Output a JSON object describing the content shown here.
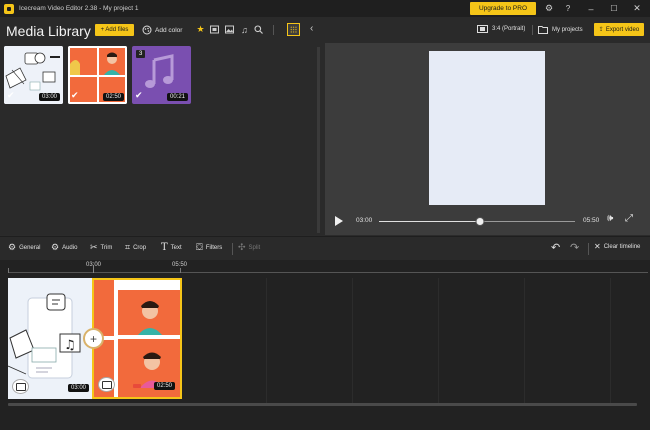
{
  "window": {
    "title": "Icecream Video Editor 2.38  -  My project 1",
    "upgrade_label": "Upgrade to PRO",
    "icons": [
      "gear-icon",
      "help-icon",
      "minimize-icon",
      "maximize-icon",
      "close-icon"
    ]
  },
  "media": {
    "title": "Media Library",
    "add_files_label": "+ Add files",
    "add_color_label": "Add color",
    "filters": [
      "star-icon",
      "video-icon",
      "image-icon",
      "music-icon",
      "search-icon"
    ],
    "items": [
      {
        "kind": "illustration",
        "duration": "03:00",
        "checked": true
      },
      {
        "kind": "video-call",
        "duration": "02:50",
        "checked": true
      },
      {
        "kind": "audio",
        "duration": "00:21",
        "checked": true,
        "badge": "3"
      }
    ]
  },
  "preview": {
    "aspect_label": "3:4 (Portrait)",
    "projects_label": "My projects",
    "export_label": "Export video",
    "current_time": "03:00",
    "total_time": "05:50",
    "progress": 0.514
  },
  "toolbar": {
    "general": "General",
    "audio": "Audio",
    "trim": "Trim",
    "crop": "Crop",
    "text": "Text",
    "filters": "Filters",
    "split": "Split",
    "clear": "Clear timeline"
  },
  "timeline": {
    "ruler": [
      "03:00",
      "05:50"
    ],
    "clips": [
      {
        "kind": "illustration",
        "duration": "03:00",
        "selected": false
      },
      {
        "kind": "video-call",
        "duration": "02:50",
        "selected": true
      }
    ]
  },
  "colors": {
    "accent": "#f5c518",
    "background": "#2a2a2a",
    "timeline_bg": "#222222",
    "preview_canvas": "#e6ebf6",
    "video_orange": "#f26a3c",
    "audio_purple": "#7a4fb0"
  }
}
